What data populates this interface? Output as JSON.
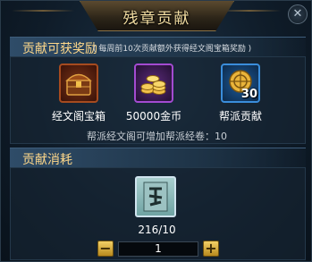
{
  "window": {
    "title": "残章贡献",
    "close_symbol": "✕"
  },
  "rewards_section": {
    "title": "贡献可获奖励",
    "note": "( 每周前10次贡献额外获得经文阁宝箱奖励 )",
    "items": [
      {
        "label": "经文阁宝箱",
        "icon": "treasure-chest-icon",
        "badge": ""
      },
      {
        "label": "50000金币",
        "icon": "gold-coins-icon",
        "badge": ""
      },
      {
        "label": "帮派贡献",
        "icon": "guild-contribution-icon",
        "badge": "30"
      }
    ],
    "hint": "帮派经文阁可增加帮派经卷：10"
  },
  "cost_section": {
    "title": "贡献消耗",
    "item_icon": "scripture-fragment-icon",
    "count": "216/10",
    "quantity": "1",
    "minus_label": "−",
    "plus_label": "+"
  },
  "colors": {
    "gold_text": "#ffd88a",
    "title_text": "#f5dfa3",
    "chest_border": "#a64b1f",
    "coin_border": "#a34bd1",
    "guild_border": "#3a8ddb"
  }
}
